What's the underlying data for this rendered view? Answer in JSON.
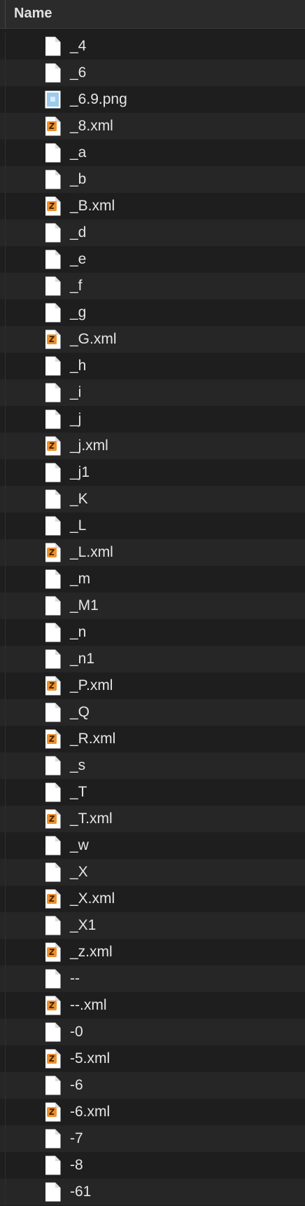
{
  "header": {
    "name_label": "Name"
  },
  "files": [
    {
      "name": "_4",
      "icon": "document-icon"
    },
    {
      "name": "_6",
      "icon": "document-icon"
    },
    {
      "name": "_6.9.png",
      "icon": "image-file-icon"
    },
    {
      "name": "_8.xml",
      "icon": "xml-file-icon"
    },
    {
      "name": "_a",
      "icon": "document-icon"
    },
    {
      "name": "_b",
      "icon": "document-icon"
    },
    {
      "name": "_B.xml",
      "icon": "xml-file-icon"
    },
    {
      "name": "_d",
      "icon": "document-icon"
    },
    {
      "name": "_e",
      "icon": "document-icon"
    },
    {
      "name": "_f",
      "icon": "document-icon"
    },
    {
      "name": "_g",
      "icon": "document-icon"
    },
    {
      "name": "_G.xml",
      "icon": "xml-file-icon"
    },
    {
      "name": "_h",
      "icon": "document-icon"
    },
    {
      "name": "_i",
      "icon": "document-icon"
    },
    {
      "name": "_j",
      "icon": "document-icon"
    },
    {
      "name": "_j.xml",
      "icon": "xml-file-icon"
    },
    {
      "name": "_j1",
      "icon": "document-icon"
    },
    {
      "name": "_K",
      "icon": "document-icon"
    },
    {
      "name": "_L",
      "icon": "document-icon"
    },
    {
      "name": "_L.xml",
      "icon": "xml-file-icon"
    },
    {
      "name": "_m",
      "icon": "document-icon"
    },
    {
      "name": "_M1",
      "icon": "document-icon"
    },
    {
      "name": "_n",
      "icon": "document-icon"
    },
    {
      "name": "_n1",
      "icon": "document-icon"
    },
    {
      "name": "_P.xml",
      "icon": "xml-file-icon"
    },
    {
      "name": "_Q",
      "icon": "document-icon"
    },
    {
      "name": "_R.xml",
      "icon": "xml-file-icon"
    },
    {
      "name": "_s",
      "icon": "document-icon"
    },
    {
      "name": "_T",
      "icon": "document-icon"
    },
    {
      "name": "_T.xml",
      "icon": "xml-file-icon"
    },
    {
      "name": "_w",
      "icon": "document-icon"
    },
    {
      "name": "_X",
      "icon": "document-icon"
    },
    {
      "name": "_X.xml",
      "icon": "xml-file-icon"
    },
    {
      "name": "_X1",
      "icon": "document-icon"
    },
    {
      "name": "_z.xml",
      "icon": "xml-file-icon"
    },
    {
      "name": "--",
      "icon": "document-icon"
    },
    {
      "name": "--.xml",
      "icon": "xml-file-icon"
    },
    {
      "name": "-0",
      "icon": "document-icon"
    },
    {
      "name": "-5.xml",
      "icon": "xml-file-icon"
    },
    {
      "name": "-6",
      "icon": "document-icon"
    },
    {
      "name": "-6.xml",
      "icon": "xml-file-icon"
    },
    {
      "name": "-7",
      "icon": "document-icon"
    },
    {
      "name": "-8",
      "icon": "document-icon"
    },
    {
      "name": "-61",
      "icon": "document-icon"
    }
  ],
  "colors": {
    "background": "#1e1e1e",
    "row_alt": "#262626",
    "header_bg": "#2b2b2b",
    "text": "#e6e6e6",
    "xml_badge": "#f0902a",
    "png_badge": "#8fc6e8"
  }
}
